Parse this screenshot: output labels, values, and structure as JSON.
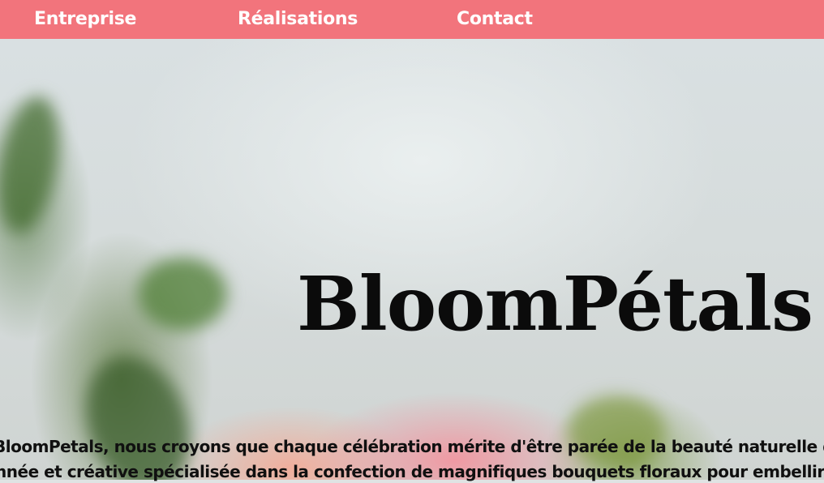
{
  "nav": {
    "items": [
      {
        "label": "Entreprise"
      },
      {
        "label": "Réalisations"
      },
      {
        "label": "Contact"
      }
    ],
    "background": "#f2747c"
  },
  "hero": {
    "title": "BloomPétals",
    "intro_line1": "ez BloomPetals, nous croyons que chaque célébration mérite d'être parée de la beauté naturelle de",
    "intro_line2": "sionnée et créative spécialisée dans la confection de magnifiques bouquets floraux pour embellir vo"
  }
}
